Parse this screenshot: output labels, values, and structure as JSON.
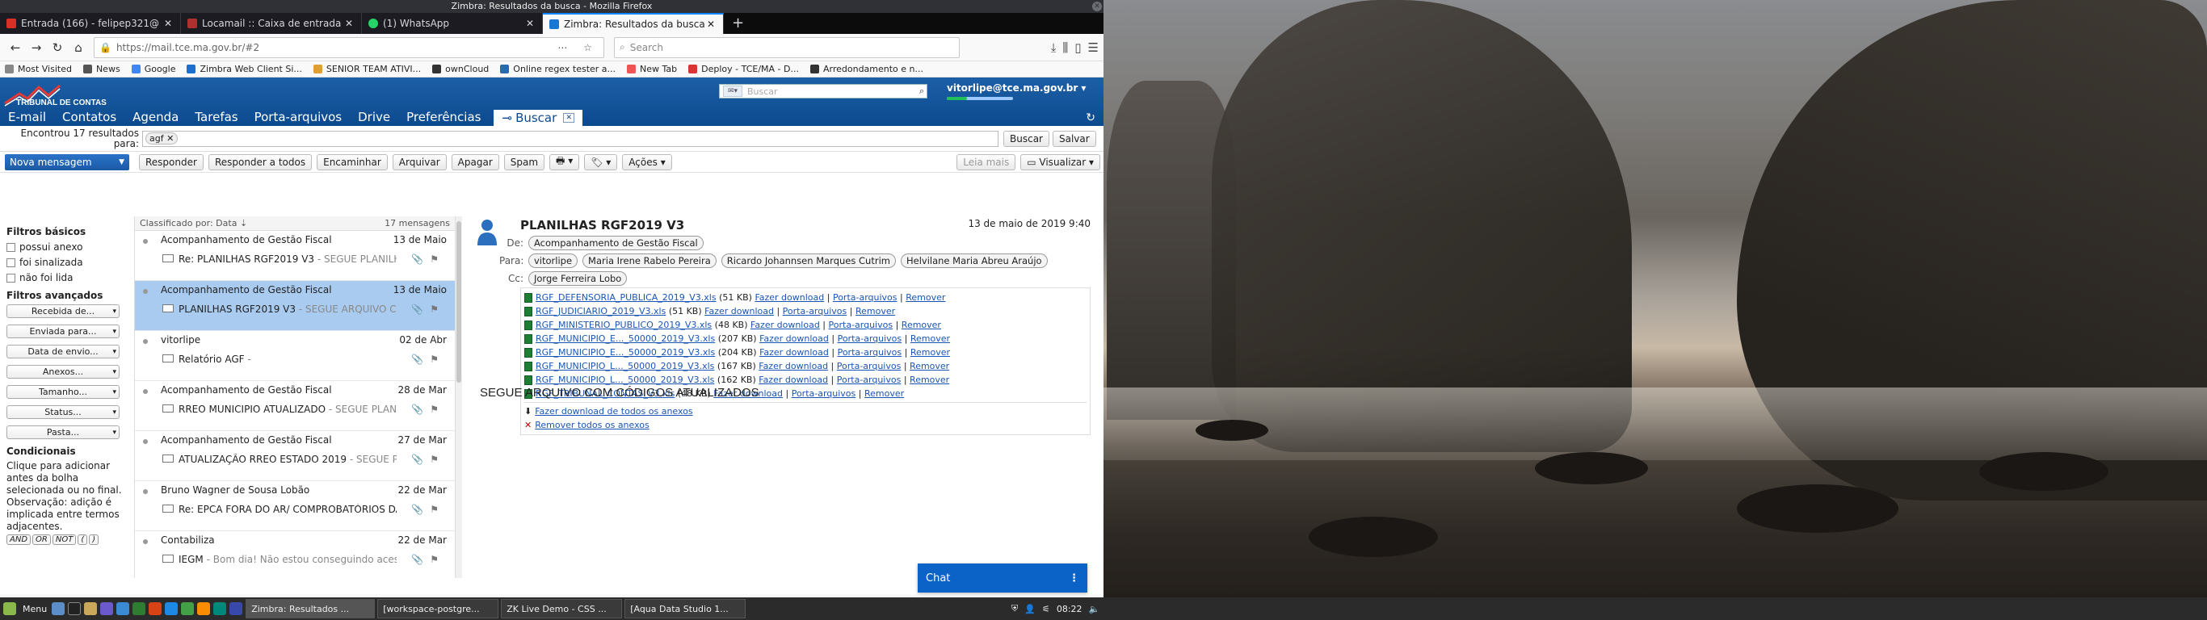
{
  "window_title": "Zimbra: Resultados da busca - Mozilla Firefox",
  "tabs": [
    {
      "label": "Entrada (166) - felipep321@",
      "color": "#d93025"
    },
    {
      "label": "Locamail :: Caixa de entrada",
      "color": "#b03030"
    },
    {
      "label": "(1) WhatsApp",
      "color": "#25d366"
    },
    {
      "label": "Zimbra: Resultados da busca",
      "color": "#1976d2"
    }
  ],
  "url": "https://mail.tce.ma.gov.br/#2",
  "search_placeholder": "Search",
  "bookmarks": [
    {
      "label": "Most Visited",
      "color": "#888"
    },
    {
      "label": "News",
      "color": "#555"
    },
    {
      "label": "Google",
      "color": "#4285f4"
    },
    {
      "label": "Zimbra Web Client Si...",
      "color": "#1a6fcf"
    },
    {
      "label": "SENIOR TEAM ATIVI...",
      "color": "#e0a030"
    },
    {
      "label": "ownCloud",
      "color": "#333"
    },
    {
      "label": "Online regex tester a...",
      "color": "#2a6ab0"
    },
    {
      "label": "New Tab",
      "color": "#e55"
    },
    {
      "label": "Deploy - TCE/MA - D...",
      "color": "#d33"
    },
    {
      "label": "Arredondamento e n...",
      "color": "#333"
    }
  ],
  "zimbra": {
    "logo_text": "TRIBUNAL DE CONTAS",
    "search_placeholder": "Buscar",
    "user": "vitorlipe@tce.ma.gov.br",
    "quota_fraction": 0.3,
    "apps": [
      "E-mail",
      "Contatos",
      "Agenda",
      "Tarefas",
      "Porta-arquivos",
      "Drive",
      "Preferências"
    ],
    "active_app": "Buscar",
    "results_label": "Encontrou 17 resultados para:",
    "query_chip": "agf",
    "btn_search": "Buscar",
    "btn_save": "Salvar",
    "new_message": "Nova mensagem",
    "toolbar": [
      "Responder",
      "Responder a todos",
      "Encaminhar",
      "Arquivar",
      "Apagar",
      "Spam",
      "Ações"
    ],
    "read_more": "Leia mais",
    "view": "Visualizar",
    "filters_basic_title": "Filtros básicos",
    "filters_basic": [
      "possui anexo",
      "foi sinalizada",
      "não foi lida"
    ],
    "filters_adv_title": "Filtros avançados",
    "filters_adv": [
      "Recebida de...",
      "Enviada para...",
      "Data de envio...",
      "Anexos...",
      "Tamanho...",
      "Status...",
      "Pasta..."
    ],
    "conditionals_title": "Condicionais",
    "conditionals_text": "Clique para adicionar antes da bolha selecionada ou no final. Observação: adição é implicada entre termos adjacentes.",
    "ops": [
      "AND",
      "OR",
      "NOT",
      "(",
      ")"
    ],
    "sort_label": "Classificado por: Data",
    "msg_count": "17 mensagens",
    "messages": [
      {
        "from": "Acompanhamento de Gestão Fiscal",
        "date": "13 de Maio",
        "subject": "Re: PLANILHAS RGF2019 V3",
        "preview": " - SEGUE PLANILHAS"
      },
      {
        "from": "Acompanhamento de Gestão Fiscal",
        "date": "13 de Maio",
        "subject": "PLANILHAS RGF2019 V3",
        "preview": " - SEGUE ARQUIVO COM"
      },
      {
        "from": "vitorlipe",
        "date": "02 de Abr",
        "subject": "Relatório AGF",
        "preview": " -"
      },
      {
        "from": "Acompanhamento de Gestão Fiscal",
        "date": "28 de Mar",
        "subject": "RREO MUNICIPIO ATUALIZADO",
        "preview": " - SEGUE PLANILHA"
      },
      {
        "from": "Acompanhamento de Gestão Fiscal",
        "date": "27 de Mar",
        "subject": "ATUALIZAÇÃO RREO ESTADO 2019",
        "preview": " - SEGUE PLANILHA"
      },
      {
        "from": "Bruno Wagner de Sousa Lobão",
        "date": "22 de Mar",
        "subject": "Re: EPCA FORA DO AR/ COMPROBATÓRIOS DA DIVIDA",
        "preview": ""
      },
      {
        "from": "Contabiliza",
        "date": "22 de Mar",
        "subject": "IEGM",
        "preview": " - Bom dia! Não estou conseguindo acessar"
      }
    ],
    "reading": {
      "subject": "PLANILHAS RGF2019 V3",
      "date": "13 de maio de 2019 9:40",
      "from_label": "De:",
      "from": "Acompanhamento de Gestão Fiscal",
      "to_label": "Para:",
      "to": [
        "vitorlipe",
        "Maria Irene Rabelo Pereira",
        "Ricardo Johannsen Marques Cutrim",
        "Helvilane Maria Abreu Araújo"
      ],
      "cc_label": "Cc:",
      "cc": [
        "Jorge Ferreira Lobo"
      ],
      "attachments": [
        {
          "name": "RGF_DEFENSORIA_PUBLICA_2019_V3.xls",
          "size": "(51 KB)"
        },
        {
          "name": "RGF_JUDICIARIO_2019_V3.xls",
          "size": "(51 KB)"
        },
        {
          "name": "RGF_MINISTERIO_PUBLICO_2019_V3.xls",
          "size": "(48 KB)"
        },
        {
          "name": "RGF_MUNICIPIO_E..._50000_2019_V3.xls",
          "size": "(207 KB)"
        },
        {
          "name": "RGF_MUNICIPIO_E..._50000_2019_V3.xls",
          "size": "(204 KB)"
        },
        {
          "name": "RGF_MUNICIPIO_L..._50000_2019_V3.xls",
          "size": "(167 KB)"
        },
        {
          "name": "RGF_MUNICIPIO_L..._50000_2019_V3.xls",
          "size": "(162 KB)"
        },
        {
          "name": "RGF_TRIBUNAL_CONTAS_V3.xls",
          "size": "(48 KB)"
        }
      ],
      "att_actions": [
        "Fazer download",
        "Porta-arquivos",
        "Remover"
      ],
      "download_all": "Fazer download de todos os anexos",
      "remove_all": "Remover todos os anexos",
      "body": "SEGUE ARQUIVO COM CÓDIGOS ATUALIZADOS"
    },
    "chat": "Chat"
  },
  "taskbar": {
    "menu": "Menu",
    "tasks": [
      "Zimbra: Resultados ...",
      "[workspace-postgre...",
      "ZK Live Demo - CSS ...",
      "[Aqua Data Studio 1..."
    ],
    "clock": "08:22"
  }
}
